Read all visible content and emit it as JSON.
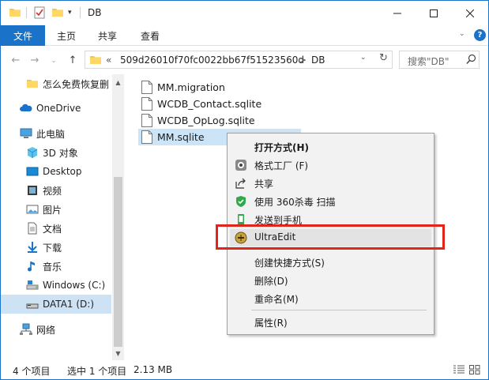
{
  "window": {
    "title": "DB"
  },
  "ribbon": {
    "tabs": [
      {
        "label": "文件",
        "active": true
      },
      {
        "label": "主页"
      },
      {
        "label": "共享"
      },
      {
        "label": "查看"
      }
    ]
  },
  "address": {
    "overflow": "«",
    "segments": [
      "509d26010f70fc0022bb67f51523560d",
      "DB"
    ],
    "separator": ">"
  },
  "search": {
    "placeholder": "搜索\"DB\""
  },
  "nav": {
    "items": [
      {
        "label": "怎么免费恢复删",
        "icon": "folder-icon"
      },
      {
        "label": "OneDrive",
        "icon": "cloud-icon"
      },
      {
        "label": "此电脑",
        "icon": "computer-icon"
      },
      {
        "label": "3D 对象",
        "icon": "cube-icon"
      },
      {
        "label": "Desktop",
        "icon": "desktop-icon"
      },
      {
        "label": "视频",
        "icon": "video-icon"
      },
      {
        "label": "图片",
        "icon": "picture-icon"
      },
      {
        "label": "文档",
        "icon": "document-icon"
      },
      {
        "label": "下载",
        "icon": "download-icon"
      },
      {
        "label": "音乐",
        "icon": "music-icon"
      },
      {
        "label": "Windows (C:)",
        "icon": "drive-icon"
      },
      {
        "label": "DATA1 (D:)",
        "icon": "drive-icon",
        "selected": true
      },
      {
        "label": "网络",
        "icon": "network-icon"
      }
    ]
  },
  "files": [
    {
      "name": "MM.migration"
    },
    {
      "name": "WCDB_Contact.sqlite"
    },
    {
      "name": "WCDB_OpLog.sqlite"
    },
    {
      "name": "MM.sqlite",
      "selected": true
    }
  ],
  "context_menu": {
    "items": [
      {
        "label": "打开方式(H)",
        "bold": true
      },
      {
        "label": "格式工厂 (F)",
        "icon": "format-factory-icon"
      },
      {
        "label": "共享",
        "icon": "share-icon"
      },
      {
        "label": "使用 360杀毒 扫描",
        "icon": "shield-360-icon"
      },
      {
        "label": "发送到手机",
        "icon": "send-phone-icon"
      },
      {
        "label": "UltraEdit",
        "icon": "ultraedit-icon",
        "hover": true
      },
      {
        "label": "创建快捷方式(S)"
      },
      {
        "label": "删除(D)"
      },
      {
        "label": "重命名(M)"
      },
      {
        "label": "属性(R)"
      }
    ]
  },
  "status": {
    "count": "4 个项目",
    "selection": "选中 1 个项目",
    "size": "2.13 MB"
  },
  "colors": {
    "accent": "#1a73c9",
    "selection": "#cce4f7",
    "highlight": "#e0251b"
  }
}
